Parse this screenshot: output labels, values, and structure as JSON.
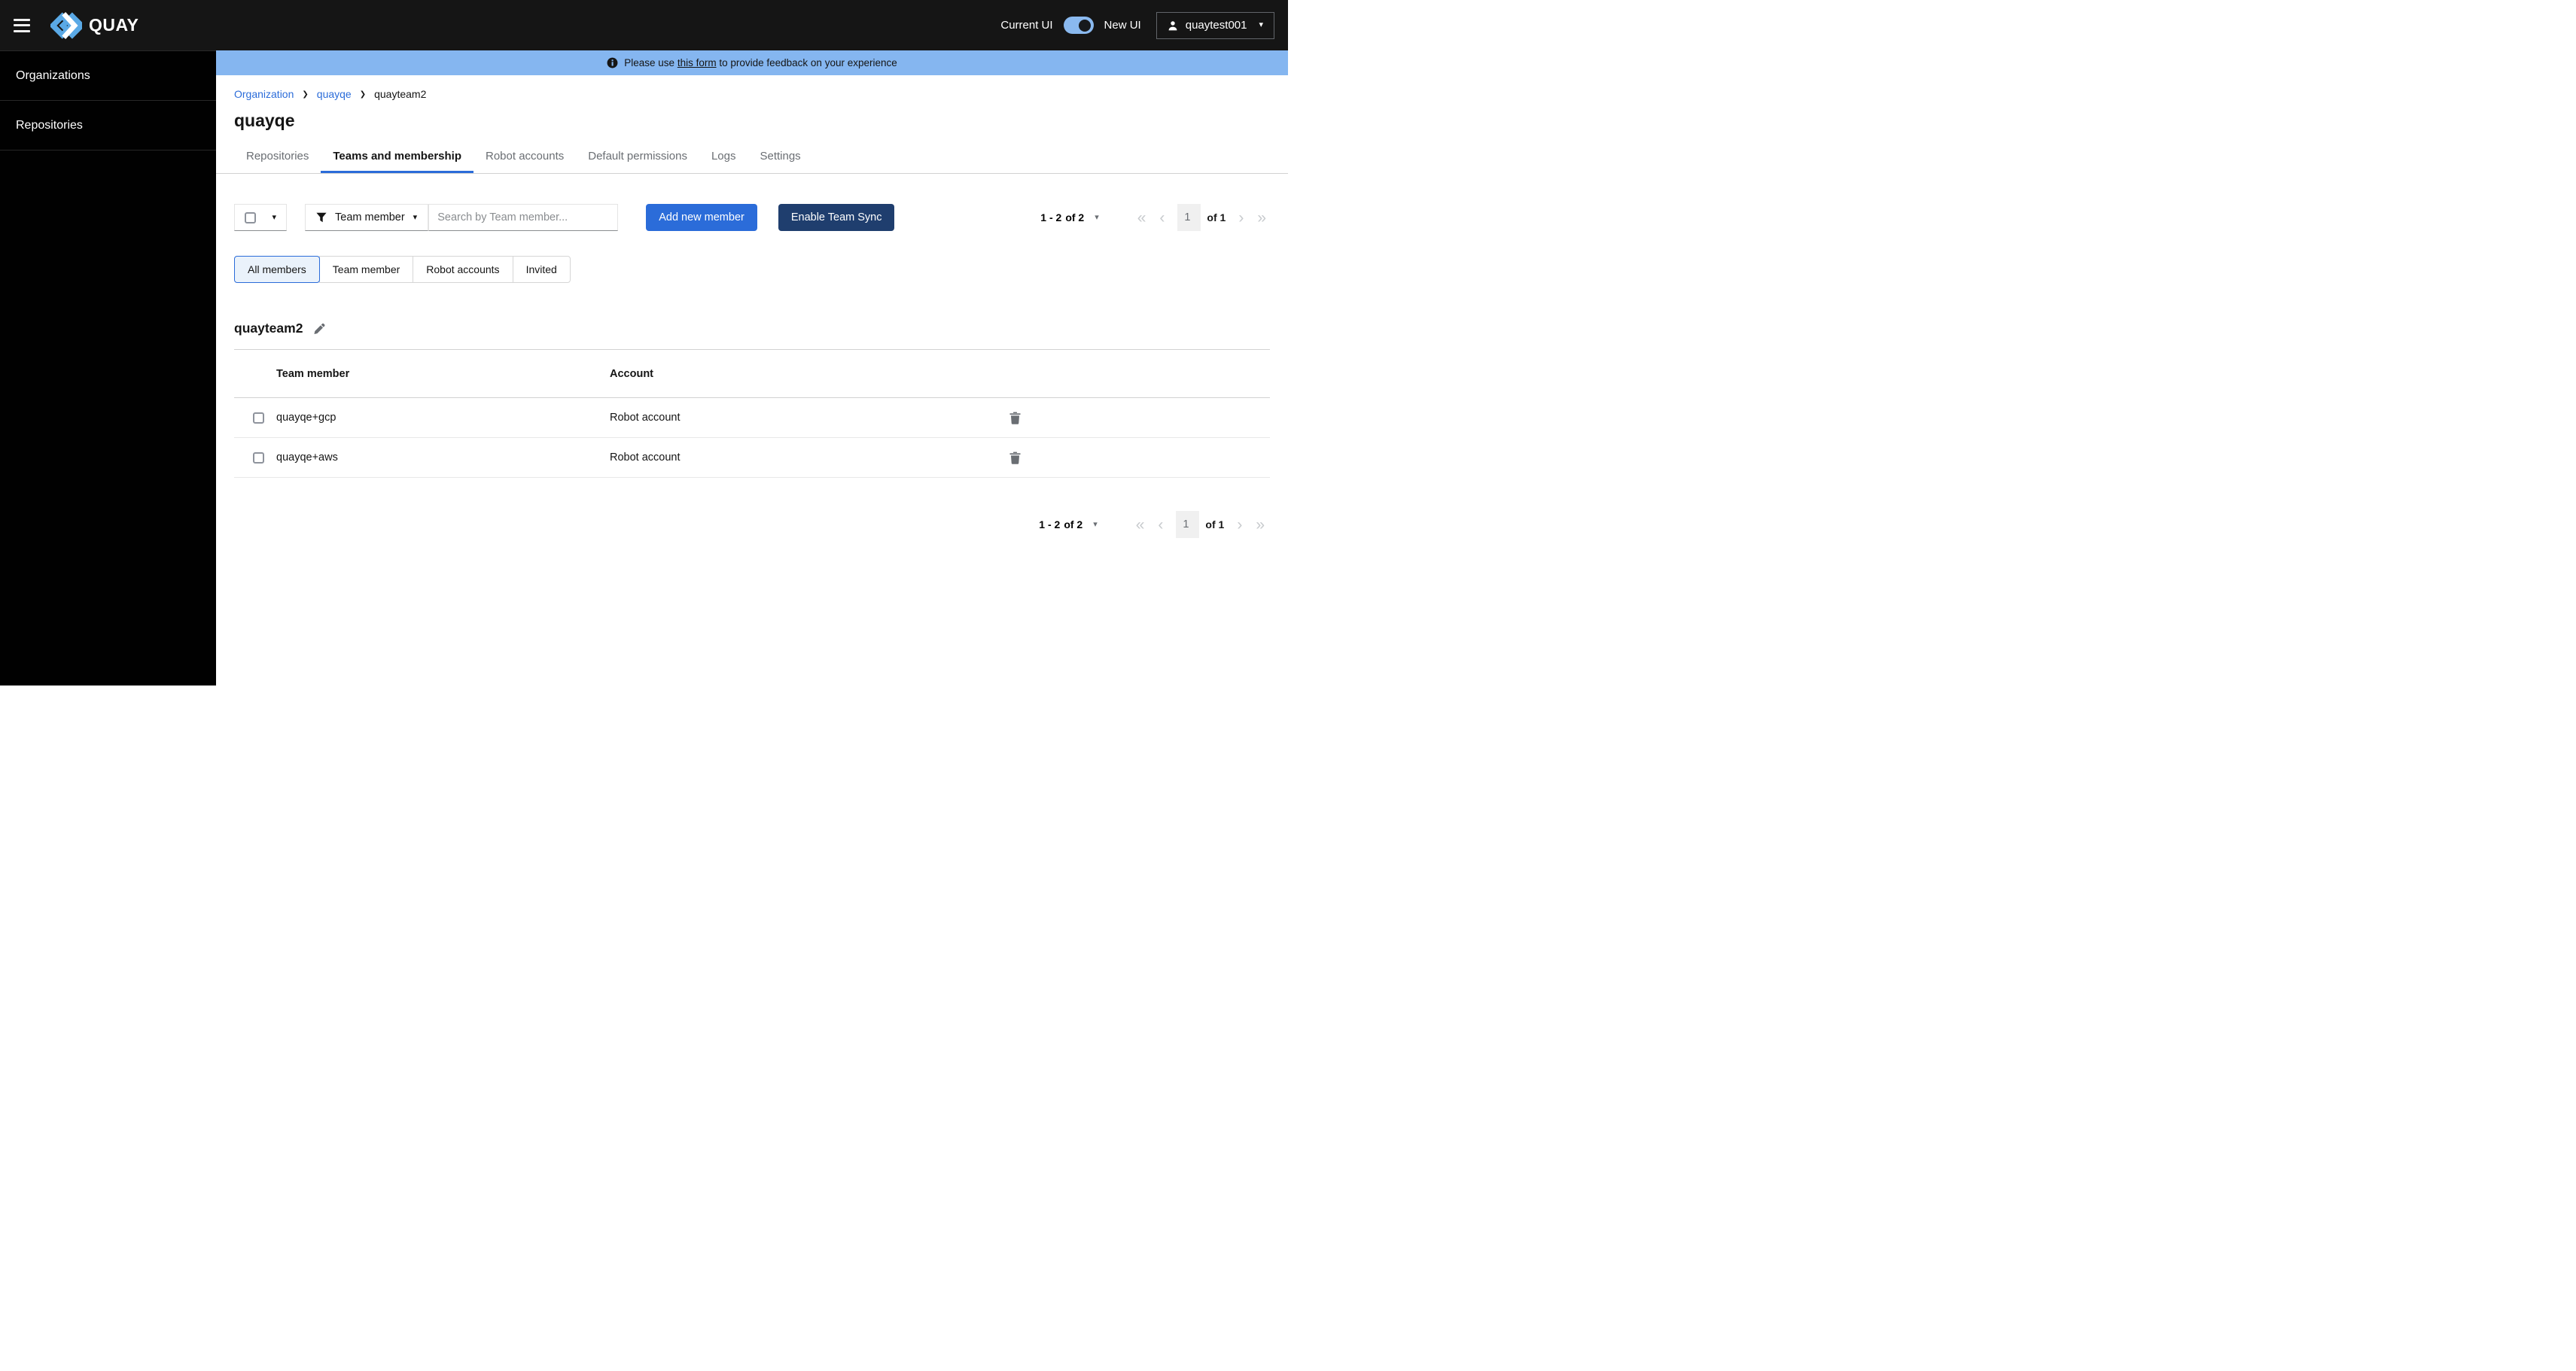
{
  "header": {
    "brand_name": "QUAY",
    "current_ui_label": "Current UI",
    "new_ui_label": "New UI",
    "user_name": "quaytest001"
  },
  "banner": {
    "prefix": "Please use",
    "link_text": "this form",
    "suffix": "to provide feedback on your experience"
  },
  "sidebar": {
    "items": [
      {
        "label": "Organizations"
      },
      {
        "label": "Repositories"
      }
    ]
  },
  "breadcrumb": {
    "items": [
      {
        "label": "Organization"
      },
      {
        "label": "quayqe"
      },
      {
        "label": "quayteam2"
      }
    ]
  },
  "page": {
    "title": "quayqe"
  },
  "tabs": [
    {
      "label": "Repositories",
      "active": false
    },
    {
      "label": "Teams and membership",
      "active": true
    },
    {
      "label": "Robot accounts",
      "active": false
    },
    {
      "label": "Default permissions",
      "active": false
    },
    {
      "label": "Logs",
      "active": false
    },
    {
      "label": "Settings",
      "active": false
    }
  ],
  "toolbar": {
    "filter_label": "Team member",
    "search_placeholder": "Search by Team member...",
    "add_member_label": "Add new member",
    "team_sync_label": "Enable Team Sync"
  },
  "view_filter": {
    "options": [
      "All members",
      "Team member",
      "Robot accounts",
      "Invited"
    ],
    "selected": "All members"
  },
  "team": {
    "name": "quayteam2"
  },
  "table": {
    "columns": [
      "Team member",
      "Account"
    ],
    "rows": [
      {
        "member": "quayqe+gcp",
        "account": "Robot account"
      },
      {
        "member": "quayqe+aws",
        "account": "Robot account"
      }
    ]
  },
  "pagination": {
    "range": "1 - 2",
    "of_items": "of 2",
    "current_page": "1",
    "of_pages": "of 1"
  },
  "colors": {
    "header_bg": "#151515",
    "banner_blue": "#85b6f0",
    "accent_blue": "#2b6cd9",
    "navy_button": "#1f3e6e",
    "switch_track": "#8ab9ef",
    "selected_toggle_bg": "#eaf2fb",
    "muted_gray": "#6a6e73"
  }
}
